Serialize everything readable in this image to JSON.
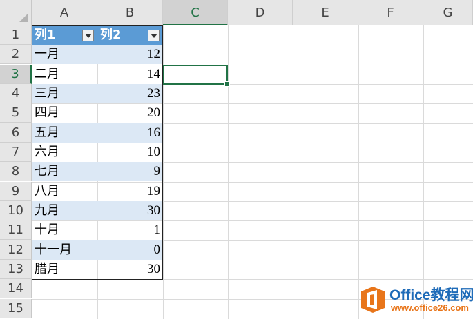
{
  "columns": [
    "A",
    "B",
    "C",
    "D",
    "E",
    "F",
    "G"
  ],
  "rows": [
    "1",
    "2",
    "3",
    "4",
    "5",
    "6",
    "7",
    "8",
    "9",
    "10",
    "11",
    "12",
    "13",
    "14",
    "15"
  ],
  "table": {
    "header": [
      "列1",
      "列2"
    ],
    "data": [
      {
        "month": "一月",
        "value": "12"
      },
      {
        "month": "二月",
        "value": "14"
      },
      {
        "month": "三月",
        "value": "23"
      },
      {
        "month": "四月",
        "value": "20"
      },
      {
        "month": "五月",
        "value": "16"
      },
      {
        "month": "六月",
        "value": "10"
      },
      {
        "month": "七月",
        "value": "9"
      },
      {
        "month": "八月",
        "value": "19"
      },
      {
        "month": "九月",
        "value": "30"
      },
      {
        "month": "十月",
        "value": "1"
      },
      {
        "month": "十一月",
        "value": "0"
      },
      {
        "month": "腊月",
        "value": "30"
      }
    ]
  },
  "selection": {
    "active_column": "C",
    "active_row": "3"
  },
  "colors": {
    "header": "#5b9bd5",
    "band": "#dce8f5",
    "accent": "#217346"
  },
  "watermark": {
    "title": "Office教程网",
    "url": "www.office26.com"
  }
}
